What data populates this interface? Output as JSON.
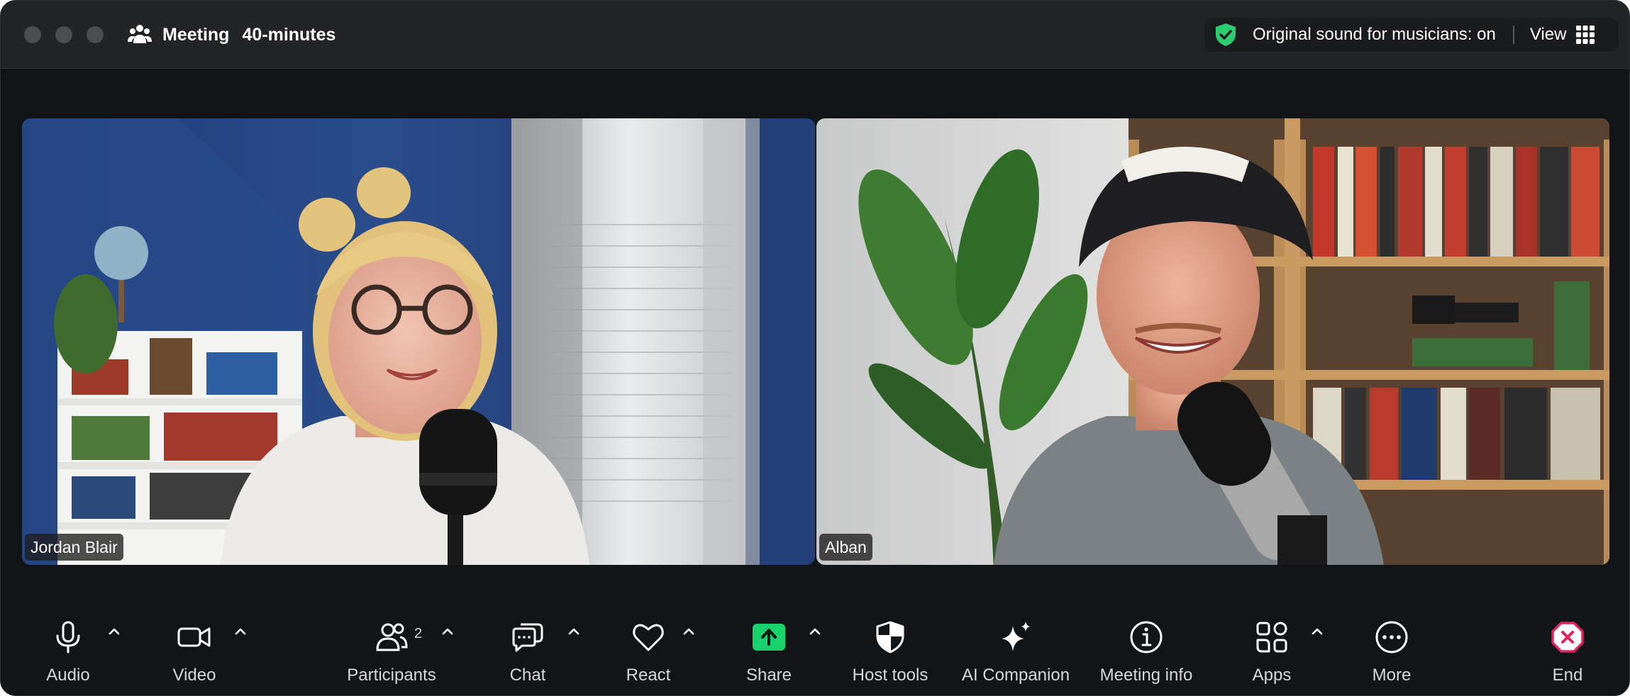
{
  "titlebar": {
    "meeting_label": "Meeting",
    "duration_label": "40-minutes",
    "sound_status": "Original sound for musicians: on",
    "view_label": "View"
  },
  "participants": [
    {
      "name": "Jordan Blair"
    },
    {
      "name": "Alban"
    }
  ],
  "toolbar": {
    "audio": "Audio",
    "video": "Video",
    "participants": "Participants",
    "participant_count": "2",
    "chat": "Chat",
    "react": "React",
    "share": "Share",
    "host_tools": "Host tools",
    "ai_companion": "AI Companion",
    "meeting_info": "Meeting info",
    "apps": "Apps",
    "more": "More",
    "end": "End"
  },
  "colors": {
    "window_bg": "#111518",
    "titlebar_bg": "#222426",
    "shield_green": "#2ecc71",
    "share_green": "#18d36b",
    "end_red": "#e0245e"
  }
}
